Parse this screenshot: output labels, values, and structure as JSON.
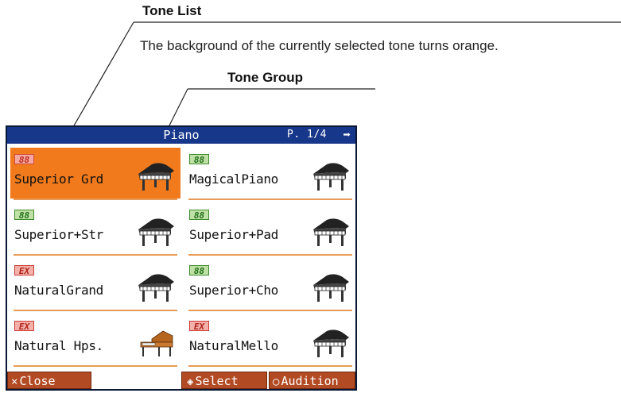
{
  "callouts": {
    "tone_list_title": "Tone List",
    "tone_list_desc": "The background of the currently selected tone turns orange.",
    "tone_group_title": "Tone Group"
  },
  "screen": {
    "group": "Piano",
    "page": "P. 1/4",
    "page_arrow_icon": "right-arrow-icon",
    "tones": [
      {
        "badge": "88",
        "name": "Superior Grd",
        "selected": true,
        "icon": "grand-piano-icon"
      },
      {
        "badge": "88",
        "name": "MagicalPiano",
        "selected": false,
        "icon": "grand-piano-icon"
      },
      {
        "badge": "88",
        "name": "Superior+Str",
        "selected": false,
        "icon": "grand-piano-icon"
      },
      {
        "badge": "88",
        "name": "Superior+Pad",
        "selected": false,
        "icon": "grand-piano-icon"
      },
      {
        "badge": "EX",
        "name": "NaturalGrand",
        "selected": false,
        "icon": "grand-piano-icon"
      },
      {
        "badge": "88",
        "name": "Superior+Cho",
        "selected": false,
        "icon": "grand-piano-icon"
      },
      {
        "badge": "EX",
        "name": "Natural Hps.",
        "selected": false,
        "icon": "harpsichord-icon"
      },
      {
        "badge": "EX",
        "name": "NaturalMello",
        "selected": false,
        "icon": "grand-piano-icon"
      }
    ],
    "footer": {
      "close_symbol": "×",
      "close_label": "Close",
      "select_symbol": "◈",
      "select_label": "Select",
      "audition_symbol": "○",
      "audition_label": "Audition"
    }
  },
  "colors": {
    "selected_bg": "#f07a1c",
    "titlebar_bg": "#17378a",
    "button_bg": "#b24a23"
  }
}
